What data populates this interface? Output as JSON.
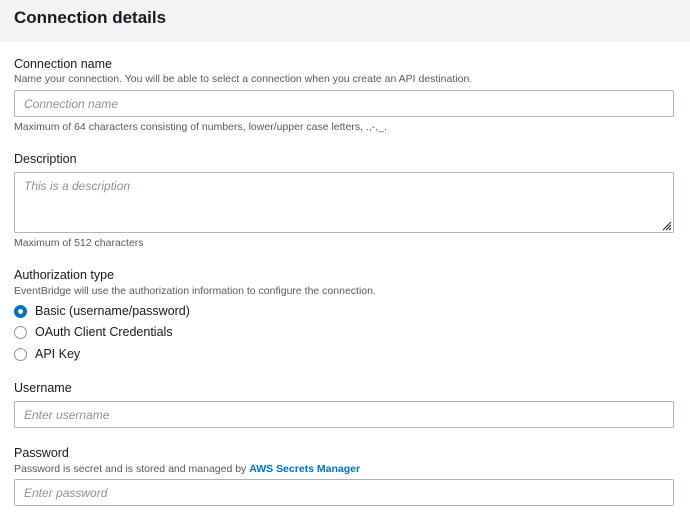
{
  "header": {
    "title": "Connection details"
  },
  "connection_name": {
    "label": "Connection name",
    "description": "Name your connection. You will be able to select a connection when you create an API destination.",
    "placeholder": "Connection name",
    "value": "",
    "constraint": "Maximum of 64 characters consisting of numbers, lower/upper case letters, .,-,_."
  },
  "description": {
    "label": "Description",
    "placeholder": "This is a description",
    "value": "",
    "constraint": "Maximum of 512 characters"
  },
  "authorization": {
    "label": "Authorization type",
    "description": "EventBridge will use the authorization information to configure the connection.",
    "selected": "Basic (username/password)",
    "options": [
      {
        "label": "Basic (username/password)",
        "checked": true
      },
      {
        "label": "OAuth Client Credentials",
        "checked": false
      },
      {
        "label": "API Key",
        "checked": false
      }
    ]
  },
  "username": {
    "label": "Username",
    "placeholder": "Enter username",
    "value": ""
  },
  "password": {
    "label": "Password",
    "description_prefix": "Password is secret and is stored and managed by ",
    "description_link": "AWS Secrets Manager",
    "placeholder": "Enter password",
    "value": ""
  },
  "colors": {
    "accent": "#0073bb",
    "header_bg": "#f2f3f3",
    "border": "#aab7b8",
    "muted_text": "#545b64",
    "placeholder": "#879596"
  }
}
